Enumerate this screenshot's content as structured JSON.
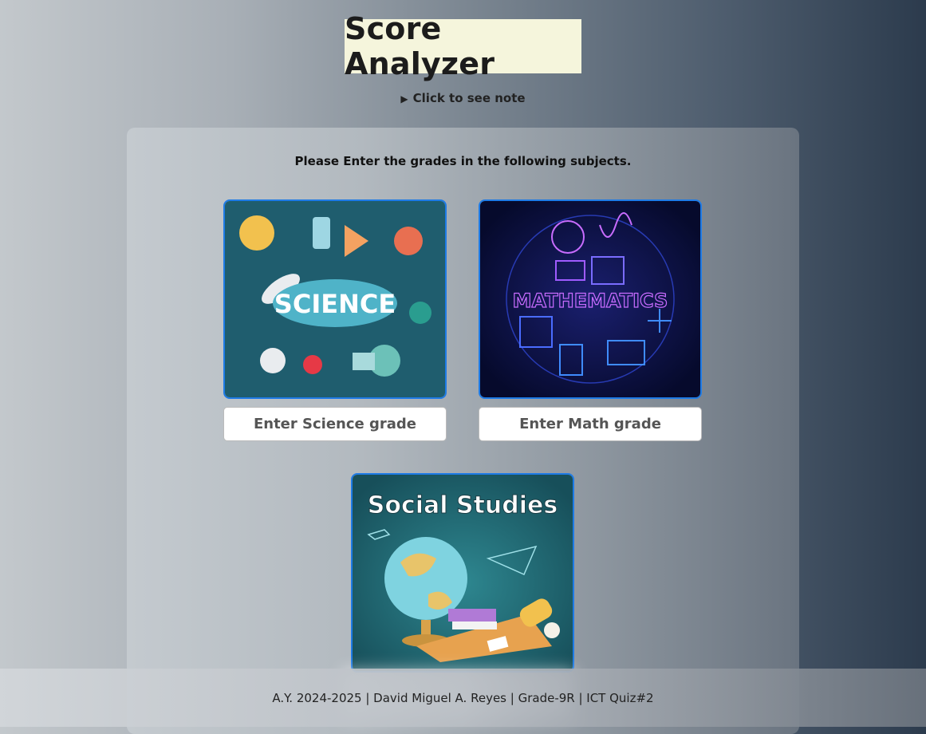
{
  "header": {
    "title": "Score Analyzer"
  },
  "note": {
    "label": "Click to see note"
  },
  "form": {
    "instructions": "Please Enter the grades in the following subjects.",
    "subjects": [
      {
        "image_text": "SCIENCE",
        "placeholder": "Enter Science grade"
      },
      {
        "image_text": "MATHEMATICS",
        "placeholder": "Enter Math grade"
      },
      {
        "image_text": "Social Studies",
        "placeholder": ""
      }
    ]
  },
  "footer": {
    "text": "A.Y. 2024-2025 | David Miguel A. Reyes | Grade-9R | ICT Quiz#2"
  },
  "colors": {
    "title_bg": "#f5f5dc",
    "card_border": "#1e7be6"
  }
}
